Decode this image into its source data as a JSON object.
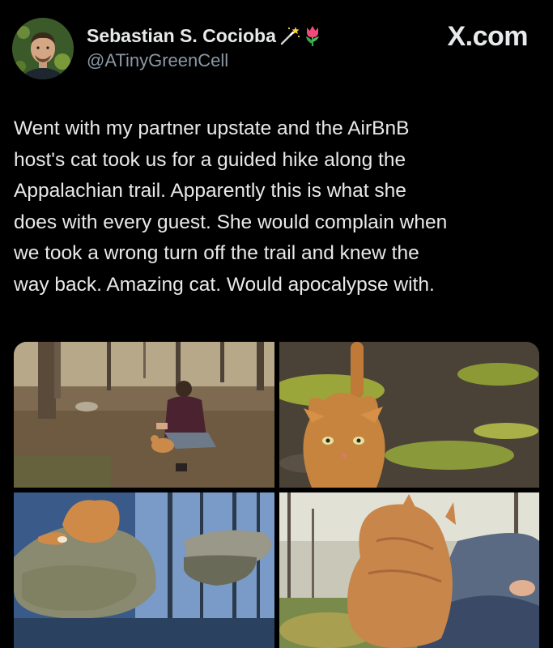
{
  "author": {
    "display_name": "Sebastian S. Cocioba",
    "handle": "@ATinyGreenCell",
    "name_emojis": [
      "magic-wand-icon",
      "tulip-icon"
    ]
  },
  "brand": "X.com",
  "tweet": {
    "lines": [
      "Went with my partner upstate and the AirBnB",
      "host's cat took us for a guided hike along the",
      "Appalachian trail. Apparently this is what she",
      "does with every guest. She would complain when",
      "we took a wrong turn off the trail and knew the",
      "way back. Amazing cat. Would apocalypse with."
    ]
  },
  "media": [
    {
      "name": "photo-man-with-cat-in-woods"
    },
    {
      "name": "photo-orange-cat-closeup-moss"
    },
    {
      "name": "photo-cat-on-rock-by-stream"
    },
    {
      "name": "photo-cat-sitting-on-lap"
    }
  ],
  "colors": {
    "background": "#000000",
    "text": "#e7e9ea",
    "secondary_text": "#8b98a5"
  }
}
